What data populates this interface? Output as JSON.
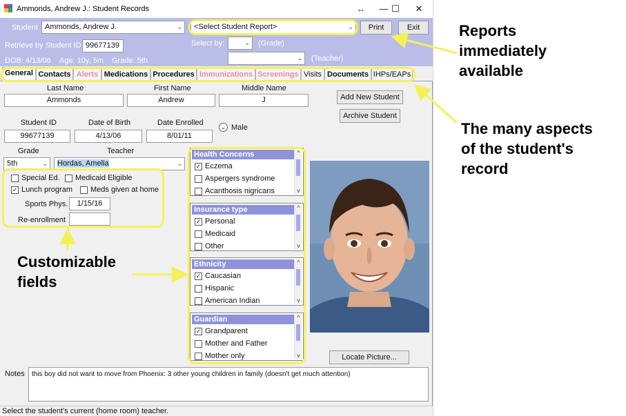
{
  "window": {
    "title": "Ammonds, Andrew J.: Student Records",
    "resize_glyph": "↔",
    "minimize_glyph": "—",
    "maximize_glyph": "☐",
    "close_glyph": "✕"
  },
  "header": {
    "student_label": "Student",
    "student_value": "Ammonds, Andrew J.",
    "report_select": "<Select Student Report>",
    "print_label": "Print",
    "exit_label": "Exit",
    "retrieve_label": "Retrieve by Student ID",
    "retrieve_value": "99677139",
    "select_by_label": "Select by:",
    "grade_label": "(Grade)",
    "teacher_label": "(Teacher)",
    "dob": "DOB: 4/13/06",
    "age": "Age: 10y, 5m",
    "grade": "Grade: 5th"
  },
  "tabs": [
    {
      "label": "General",
      "state": "active"
    },
    {
      "label": "Contacts",
      "state": "normal"
    },
    {
      "label": "Alerts",
      "state": "pink"
    },
    {
      "label": "Medications",
      "state": "normal"
    },
    {
      "label": "Procedures",
      "state": "normal"
    },
    {
      "label": "Immunizations",
      "state": "pink"
    },
    {
      "label": "Screenings",
      "state": "pink"
    },
    {
      "label": "Visits",
      "state": "plain"
    },
    {
      "label": "Documents",
      "state": "normal"
    },
    {
      "label": "IHPs/EAPs",
      "state": "plain"
    }
  ],
  "form": {
    "last_name_label": "Last Name",
    "last_name_value": "Ammonds",
    "first_name_label": "First Name",
    "first_name_value": "Andrew",
    "middle_name_label": "Middle Name",
    "middle_name_value": "J",
    "add_new_student": "Add New Student",
    "archive_student": "Archive Student",
    "student_id_label": "Student ID",
    "student_id_value": "99677139",
    "dob_label": "Date of Birth",
    "dob_value": "4/13/06",
    "date_enrolled_label": "Date Enrolled",
    "date_enrolled_value": "8/01/11",
    "gender_value": "Male",
    "grade_label": "Grade",
    "grade_value": "5th",
    "teacher_label": "Teacher",
    "teacher_value": "Hordas, Amelia",
    "special_ed": "Special Ed.",
    "medicaid_eligible": "Medicaid Eligible",
    "lunch_program": "Lunch program",
    "meds_given": "Meds given at home",
    "sports_phys_label": "Sports Phys.",
    "sports_phys_value": "1/15/16",
    "reenrollment_label": "Re-enrollment",
    "reenrollment_value": "",
    "locate_picture": "Locate Picture...",
    "notes_label": "Notes",
    "notes_value": "this boy did not want to move from Phoenix: 3 other young children in family (doesn't get much attention)"
  },
  "checks": {
    "special_ed": false,
    "medicaid_eligible": false,
    "lunch_program": true,
    "meds_given": false
  },
  "panels": [
    {
      "title": "Health Concerns",
      "items": [
        {
          "label": "Eczema",
          "checked": true
        },
        {
          "label": "Aspergers syndrome",
          "checked": false
        },
        {
          "label": "Acanthosis nigricans",
          "checked": false
        }
      ]
    },
    {
      "title": "Insurance type",
      "items": [
        {
          "label": "Personal",
          "checked": true
        },
        {
          "label": "Medicaid",
          "checked": false
        },
        {
          "label": "Other",
          "checked": false
        }
      ]
    },
    {
      "title": "Ethnicity",
      "items": [
        {
          "label": "Caucasian",
          "checked": true
        },
        {
          "label": "Hispanic",
          "checked": false
        },
        {
          "label": "American Indian",
          "checked": false
        }
      ]
    },
    {
      "title": "Guardian",
      "items": [
        {
          "label": "Grandparent",
          "checked": true
        },
        {
          "label": "Mother and Father",
          "checked": false
        },
        {
          "label": "Mother only",
          "checked": false
        }
      ]
    }
  ],
  "status_bar": "Select the student's current (home room) teacher.",
  "annotations": {
    "reports": [
      "Reports",
      "immediately",
      "available"
    ],
    "aspects": [
      "The many aspects",
      "of the student's",
      "record"
    ],
    "custom": [
      "Customizable",
      "fields"
    ]
  },
  "colors": {
    "header_band": "#b9bde8",
    "panel_header": "#8e92db",
    "annotation": "#f5f05a",
    "pink_tab": "#f08aa8",
    "teacher_highlight": "#b8d6f5"
  }
}
